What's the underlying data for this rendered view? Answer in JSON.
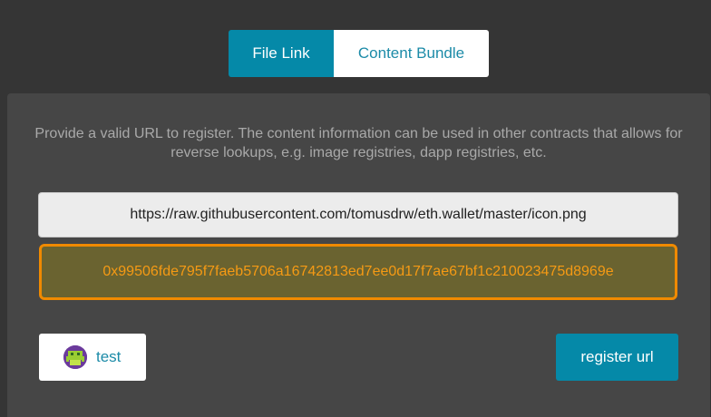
{
  "tabs": {
    "file_link": "File Link",
    "content_bundle": "Content Bundle"
  },
  "panel": {
    "description": "Provide a valid URL to register. The content information can be used in other contracts that allows for reverse lookups, e.g. image registries, dapp registries, etc.",
    "url_value": "https://raw.githubusercontent.com/tomusdrw/eth.wallet/master/icon.png",
    "hash_value": "0x99506fde795f7faeb5706a16742813ed7ee0d17f7ae67bf1c210023475d8969e"
  },
  "account": {
    "name": "test",
    "avatar_icon": "identicon-avatar-icon"
  },
  "actions": {
    "register_label": "register url"
  },
  "colors": {
    "background": "#353535",
    "panel": "#464646",
    "accent": "#0589a8",
    "hash_border": "#f08a00",
    "hash_background": "#6a6330",
    "hash_text": "#f59a14"
  }
}
